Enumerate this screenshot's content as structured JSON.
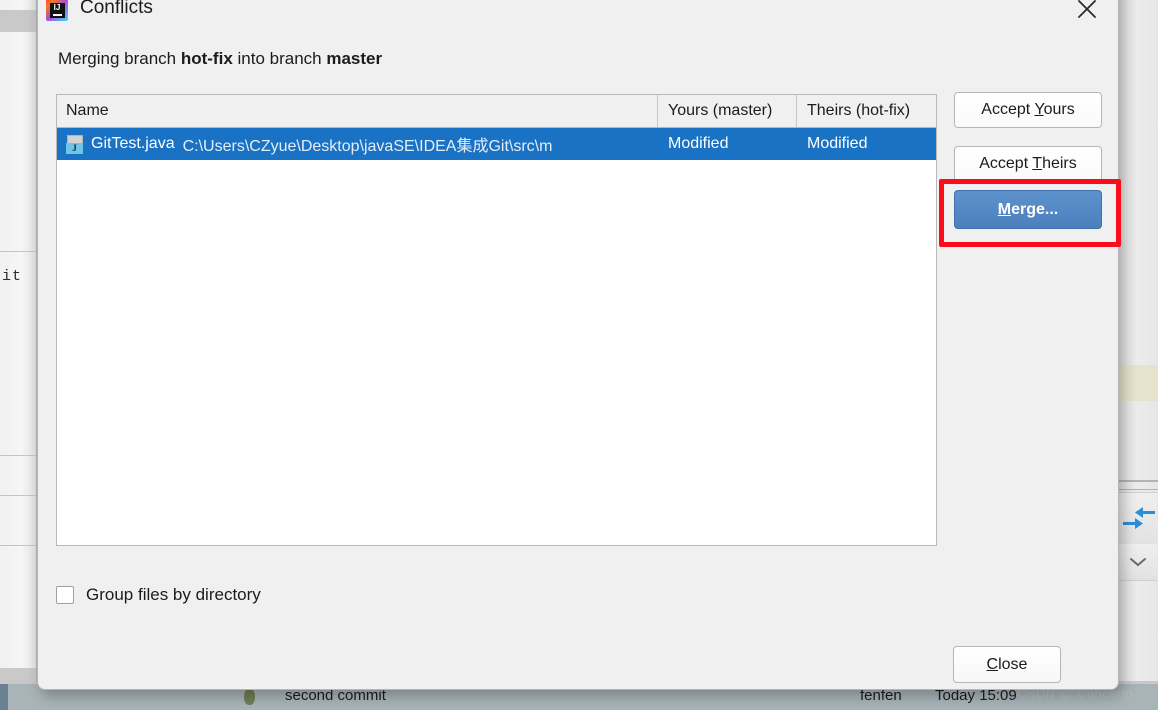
{
  "dialog": {
    "title": "Conflicts",
    "logo_text": "IJ",
    "close_icon": "close-icon",
    "description": {
      "prefix": "Merging branch ",
      "source_branch": "hot-fix",
      "middle": " into branch ",
      "target_branch": "master"
    }
  },
  "table": {
    "columns": [
      {
        "key": "name",
        "label": "Name"
      },
      {
        "key": "yours",
        "label": "Yours (master)"
      },
      {
        "key": "theirs",
        "label": "Theirs (hot-fix)"
      }
    ],
    "rows": [
      {
        "icon": "java-file-icon",
        "icon_badge": "J",
        "file_name": "GitTest.java",
        "file_path": "C:\\Users\\CZyue\\Desktop\\javaSE\\IDEA集成Git\\src\\m",
        "yours": "Modified",
        "theirs": "Modified",
        "selected": true
      }
    ]
  },
  "buttons": {
    "accept_yours": {
      "pre": "Accept ",
      "mnemonic": "Y",
      "post": "ours"
    },
    "accept_theirs": {
      "pre": "Accept ",
      "mnemonic": "T",
      "post": "heirs"
    },
    "merge": {
      "pre": "",
      "mnemonic": "M",
      "post": "erge..."
    },
    "close": {
      "pre": "",
      "mnemonic": "C",
      "post": "lose"
    }
  },
  "checkbox": {
    "label": "Group files by directory",
    "checked": false
  },
  "annotation": {
    "shape": "rectangle",
    "color": "#fc0d1b",
    "targets": "merge-button"
  },
  "background": {
    "editor_fragment": "it",
    "commit": {
      "message": "second commit",
      "author": "fenfen",
      "time": "Today 15:09"
    },
    "watermark": "CSDN @:Concerto",
    "right_icons": [
      "merge-arrows-icon",
      "chevron-down-icon"
    ]
  },
  "colors": {
    "selection_blue": "#1a72c4",
    "merge_button_blue": "#4b80bd",
    "annotation_red": "#fc0d1b",
    "dialog_background": "#f0f0f0"
  }
}
